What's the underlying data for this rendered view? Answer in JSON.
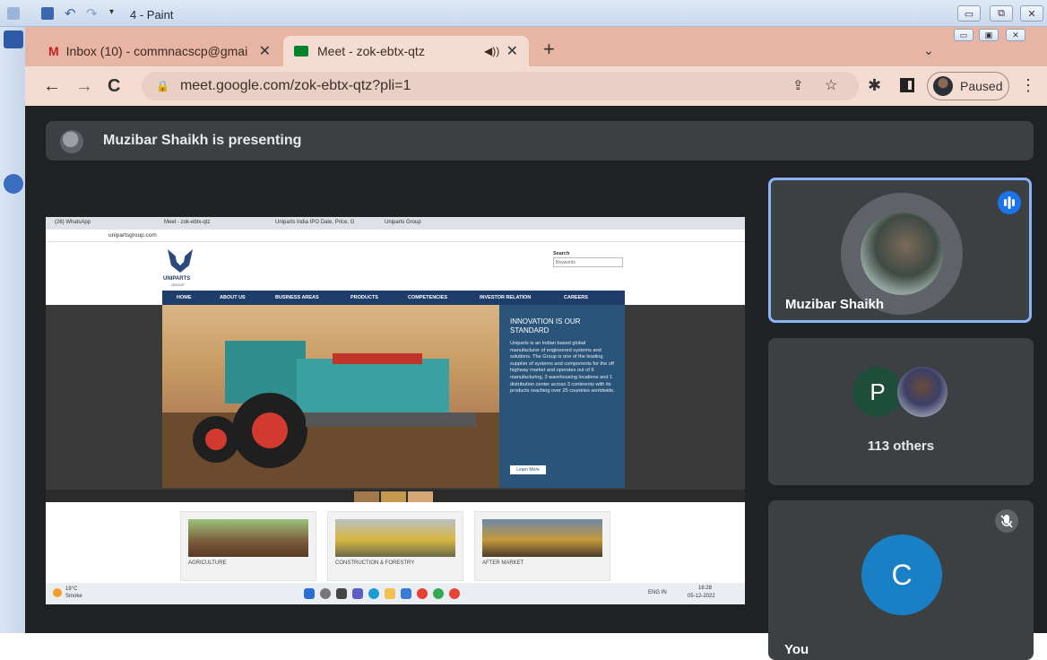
{
  "paint": {
    "title": "4 - Paint",
    "controls": {
      "minimize": "▭",
      "restore": "⧉",
      "close": "✕"
    }
  },
  "browser": {
    "tabs": [
      {
        "label": "Inbox (10) - commnacscp@gmai",
        "icon": "gmail-icon"
      },
      {
        "label": "Meet - zok-ebtx-qtz",
        "icon": "meet-icon",
        "audio": "🔊"
      }
    ],
    "new_tab": "+",
    "url": "meet.google.com/zok-ebtx-qtz?pli=1",
    "profile_status": "Paused",
    "inner_controls": {
      "minimize": "▭",
      "restore": "▣",
      "close": "✕"
    }
  },
  "meet": {
    "presenting_banner": "Muzibar Shaikh is presenting",
    "participants": [
      {
        "name": "Muzibar Shaikh",
        "state": "speaking"
      },
      {
        "initial": "P",
        "others": "113 others"
      },
      {
        "initial": "C",
        "name": "You",
        "state": "muted"
      }
    ]
  },
  "shared_screen": {
    "tabs": [
      "(26) WhatsApp",
      "Meet - zok-ebtx-qtz",
      "Uniparts India IPO Date, Price, G",
      "Uniparts Group"
    ],
    "url": "unipartsgroup.com",
    "logo_text": "UNIPARTS",
    "logo_sub": "GROUP",
    "search_label": "Search",
    "search_placeholder": "Keywords",
    "nav": [
      "HOME",
      "ABOUT US",
      "BUSINESS AREAS",
      "PRODUCTS",
      "COMPETENCIES",
      "INVESTOR RELATION",
      "CAREERS"
    ],
    "hero_heading": "INNOVATION IS OUR STANDARD",
    "hero_body": "Uniparts is an Indian based global manufacturer of engineered systems and solutions. The Group is one of the leading supplier of systems and components for the off highway market and operates out of 6 manufacturing, 3 warehousing locations and 1 distribution center across 3 continents with its products reaching over 25 countries worldwide.",
    "learn_more": "Learn More",
    "cards": [
      "AGRICULTURE",
      "CONSTRUCTION & FORESTRY",
      "AFTER MARKET"
    ],
    "taskbar": {
      "weather_temp": "19°C",
      "weather_desc": "Smoke",
      "lang": "ENG IN",
      "time": "16:28",
      "date": "05-12-2022"
    }
  },
  "colors": {
    "accent_blue": "#1a73e8",
    "tab_strip": "#e8b4a4",
    "meet_bg": "#202124"
  }
}
